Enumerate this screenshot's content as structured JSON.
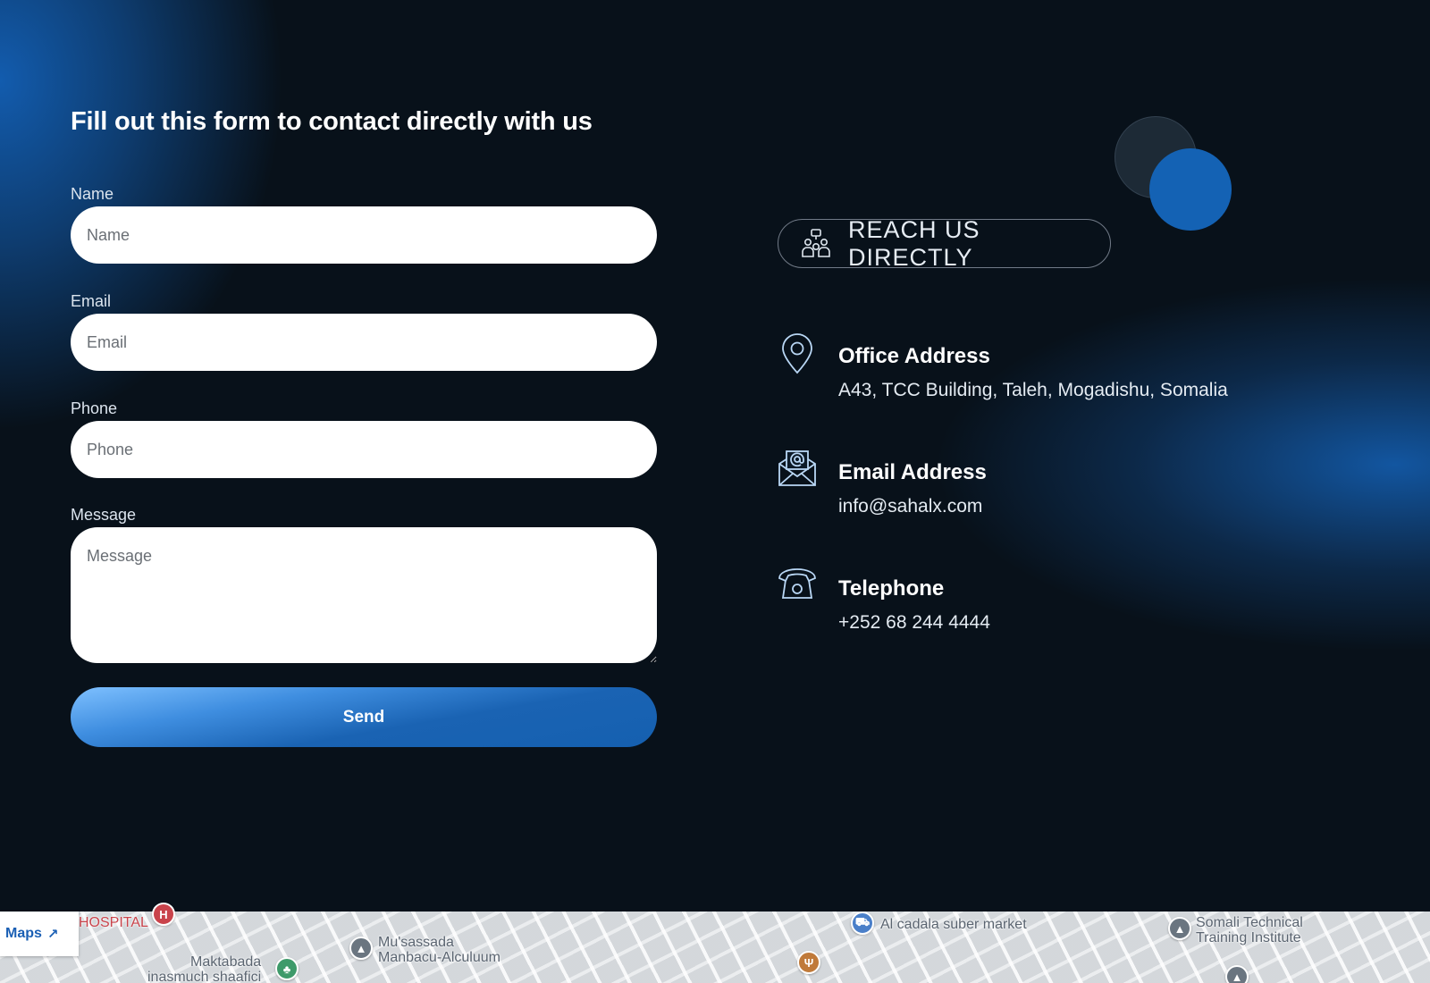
{
  "form": {
    "title": "Fill out this form to contact directly with us",
    "fields": [
      {
        "label": "Name",
        "placeholder": "Name"
      },
      {
        "label": "Email",
        "placeholder": "Email"
      },
      {
        "label": "Phone",
        "placeholder": "Phone"
      },
      {
        "label": "Message",
        "placeholder": "Message"
      }
    ],
    "submit_label": "Send"
  },
  "contact": {
    "badge": "REACH US DIRECTLY",
    "items": [
      {
        "title": "Office Address",
        "value": "A43, TCC Building, Taleh, Mogadishu, Somalia",
        "icon": "map-pin-icon"
      },
      {
        "title": "Email Address",
        "value": "info@sahalx.com",
        "icon": "envelope-icon"
      },
      {
        "title": "Telephone",
        "value": "+252 68 244 4444",
        "icon": "telephone-icon"
      }
    ]
  },
  "map": {
    "link_label": "Maps",
    "places": [
      {
        "label": "HOSPITAL",
        "icon": "hospital-pin-icon"
      },
      {
        "label": "Mu'sassada\nManbacu-Alculuum",
        "icon": "school-pin-icon"
      },
      {
        "label": "Maktabada\ninasmuch shaafici",
        "icon": "library-pin-icon"
      },
      {
        "label": "Al cadala suber market",
        "icon": "shopping-pin-icon"
      },
      {
        "label": "Somali Technical\nTraining Institute",
        "icon": "school-pin-icon"
      }
    ]
  },
  "colors": {
    "background": "#08111a",
    "accent": "#1462b4",
    "button_light": "#7ec0ff"
  }
}
